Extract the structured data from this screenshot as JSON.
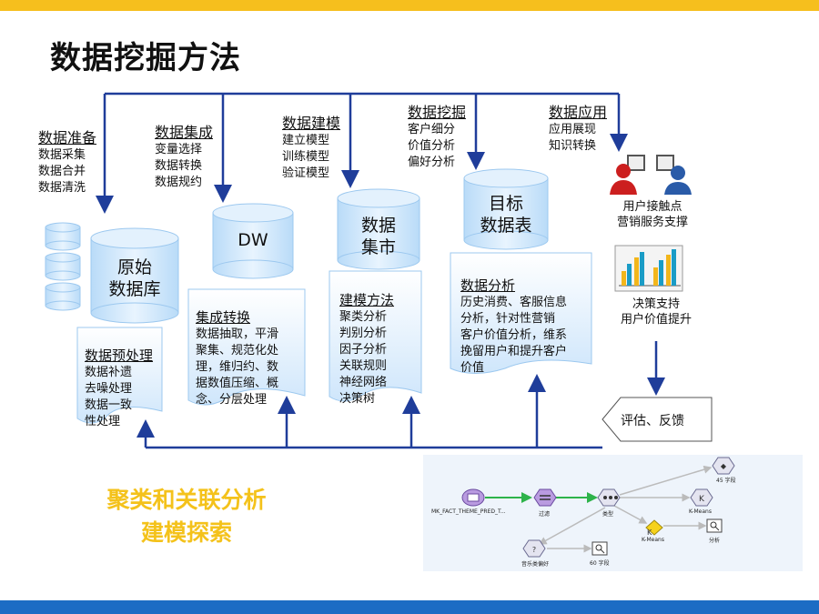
{
  "title": "数据挖掘方法",
  "colors": {
    "top_band": "#f6bf1d",
    "bottom_band": "#1c6cc4",
    "flow_line": "#1f3d9a",
    "cylinder": "#cfe6fb",
    "slogan": "#f4c21b"
  },
  "stages": [
    {
      "heading": "数据准备",
      "items": [
        "数据采集",
        "数据合并",
        "数据清洗"
      ]
    },
    {
      "heading": "数据集成",
      "items": [
        "变量选择",
        "数据转换",
        "数据规约"
      ]
    },
    {
      "heading": "数据建模",
      "items": [
        "建立模型",
        "训练模型",
        "验证模型"
      ]
    },
    {
      "heading": "数据挖掘",
      "items": [
        "客户细分",
        "价值分析",
        "偏好分析"
      ]
    },
    {
      "heading": "数据应用",
      "items": [
        "应用展现",
        "知识转换"
      ]
    }
  ],
  "stores": {
    "raw_db": "原始\n数据库",
    "dw": "DW",
    "mart": "数据\n集市",
    "target": "目标\n数据表"
  },
  "docs": [
    {
      "heading": "数据预处理",
      "body": "数据补遗\n去噪处理\n数据一致\n性处理"
    },
    {
      "heading": "集成转换",
      "body": "数据抽取，平滑\n聚集、规范化处\n理，维归约、数\n据数值压缩、概\n念、分层处理"
    },
    {
      "heading": "建模方法",
      "body": "聚类分析\n判别分析\n因子分析\n关联规则\n神经网络\n决策树"
    },
    {
      "heading": "数据分析",
      "body": "历史消费、客服信息\n分析，针对性营销\n客户价值分析，维系\n挽留用户和提升客户\n价值"
    }
  ],
  "touchpoint": {
    "line1": "用户接触点",
    "line2": "营销服务支撑"
  },
  "decision": {
    "line1": "决策支持",
    "line2": "用户价值提升"
  },
  "feedback": "评估、反馈",
  "slogan": {
    "line1": "聚类和关联分析",
    "line2": "建模探索"
  },
  "stream_nodes": {
    "source": "MK_FACT_THEME_PRED_T...",
    "filter": "过滤",
    "type": "类型",
    "fields45": "45 字段",
    "kmeans_model": "K-Means",
    "kmeans": "K-Means",
    "analysis": "分析",
    "pref": "音乐类偏好",
    "fields60": "60 字段"
  }
}
